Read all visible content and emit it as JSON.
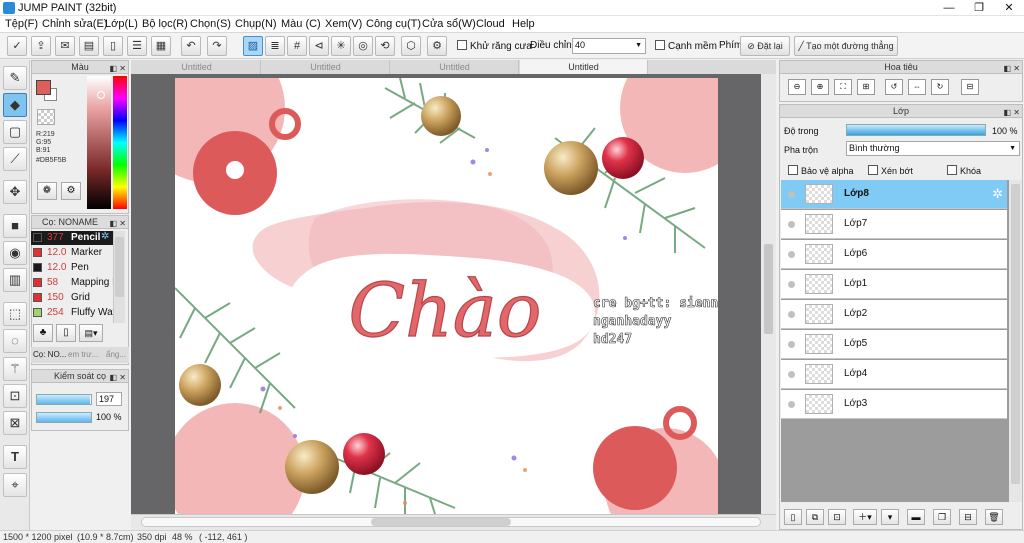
{
  "window": {
    "title": "JUMP PAINT (32bit)",
    "minimize": "—",
    "maximize": "❐",
    "close": "✕"
  },
  "menu": [
    "Tệp(F)",
    "Chỉnh sửa(E)",
    "Lớp(L)",
    "Bộ lọc(R)",
    "Chọn(S)",
    "Chụp(N)",
    "Màu (C)",
    "Xem(V)",
    "Công cụ(T)",
    "Cửa sổ(W)",
    "Cloud",
    "Help"
  ],
  "toolbar": {
    "antialias_label": "Khử răng cưa",
    "adjust_label": "Điều chỉnh",
    "adjust_value": "40",
    "soft_edge_label": "Cạnh mềm",
    "key_label": "Phím",
    "reset_label": "Đặt lại",
    "straight_line_label": "Tạo một đường thẳng"
  },
  "color_panel": {
    "title": "Màu",
    "r": "R:219",
    "g": "G:95",
    "b": "B:91",
    "hex": "#DB5F5B",
    "fg_color": "#DB5F5B",
    "bg_color": "#FFFFFF"
  },
  "brush_panel": {
    "title": "Cọ: NONAME",
    "brushes": [
      {
        "size": "377",
        "name": "Pencil",
        "color": "#1a1a1a",
        "selected": true
      },
      {
        "size": "12.0",
        "name": "Marker",
        "color": "#e23030",
        "selected": false
      },
      {
        "size": "12.0",
        "name": "Pen",
        "color": "#1a1a1a",
        "selected": false
      },
      {
        "size": "58",
        "name": "Mapping P",
        "color": "#e23030",
        "selected": false
      },
      {
        "size": "150",
        "name": "Grid",
        "color": "#e23030",
        "selected": false
      },
      {
        "size": "254",
        "name": "Fluffy Wat",
        "color": "#a3d36e",
        "selected": false
      }
    ],
    "tabs": [
      "Cọ: NO...",
      "em trư...",
      "ẩng..."
    ]
  },
  "brush_control": {
    "title": "Kiểm soát cọ",
    "size_value": "197",
    "opacity_value": "100 %",
    "size_fraction": 0.98,
    "opacity_fraction": 1.0
  },
  "document_tabs": [
    "Untitled",
    "Untitled",
    "Untitled",
    "Untitled"
  ],
  "navigator": {
    "title": "Hoa tiêu"
  },
  "layers_panel": {
    "title": "Lớp",
    "opacity_label": "Độ trong",
    "opacity_value": "100 %",
    "opacity_fraction": 1.0,
    "blend_label": "Pha trộn",
    "blend_value": "Bình thường",
    "protect_alpha_label": "Bảo vệ alpha",
    "clipping_label": "Xén bớt",
    "lock_label": "Khóa",
    "layers": [
      {
        "name": "Lớp8",
        "selected": true
      },
      {
        "name": "Lớp7",
        "selected": false
      },
      {
        "name": "Lớp6",
        "selected": false
      },
      {
        "name": "Lớp1",
        "selected": false
      },
      {
        "name": "Lớp2",
        "selected": false
      },
      {
        "name": "Lớp5",
        "selected": false
      },
      {
        "name": "Lớp4",
        "selected": false
      },
      {
        "name": "Lớp3",
        "selected": false
      }
    ]
  },
  "artwork": {
    "title_text": "Chào",
    "credit_lines": [
      "cre bg+tt: sienna",
      "nganhadayy",
      "hd247"
    ]
  },
  "status": {
    "size": "1500 * 1200 pixel",
    "physical": "(10.9 * 8.7cm)",
    "dpi": "350 dpi",
    "zoom": "48 %",
    "coords": "( -112, 461 )"
  }
}
